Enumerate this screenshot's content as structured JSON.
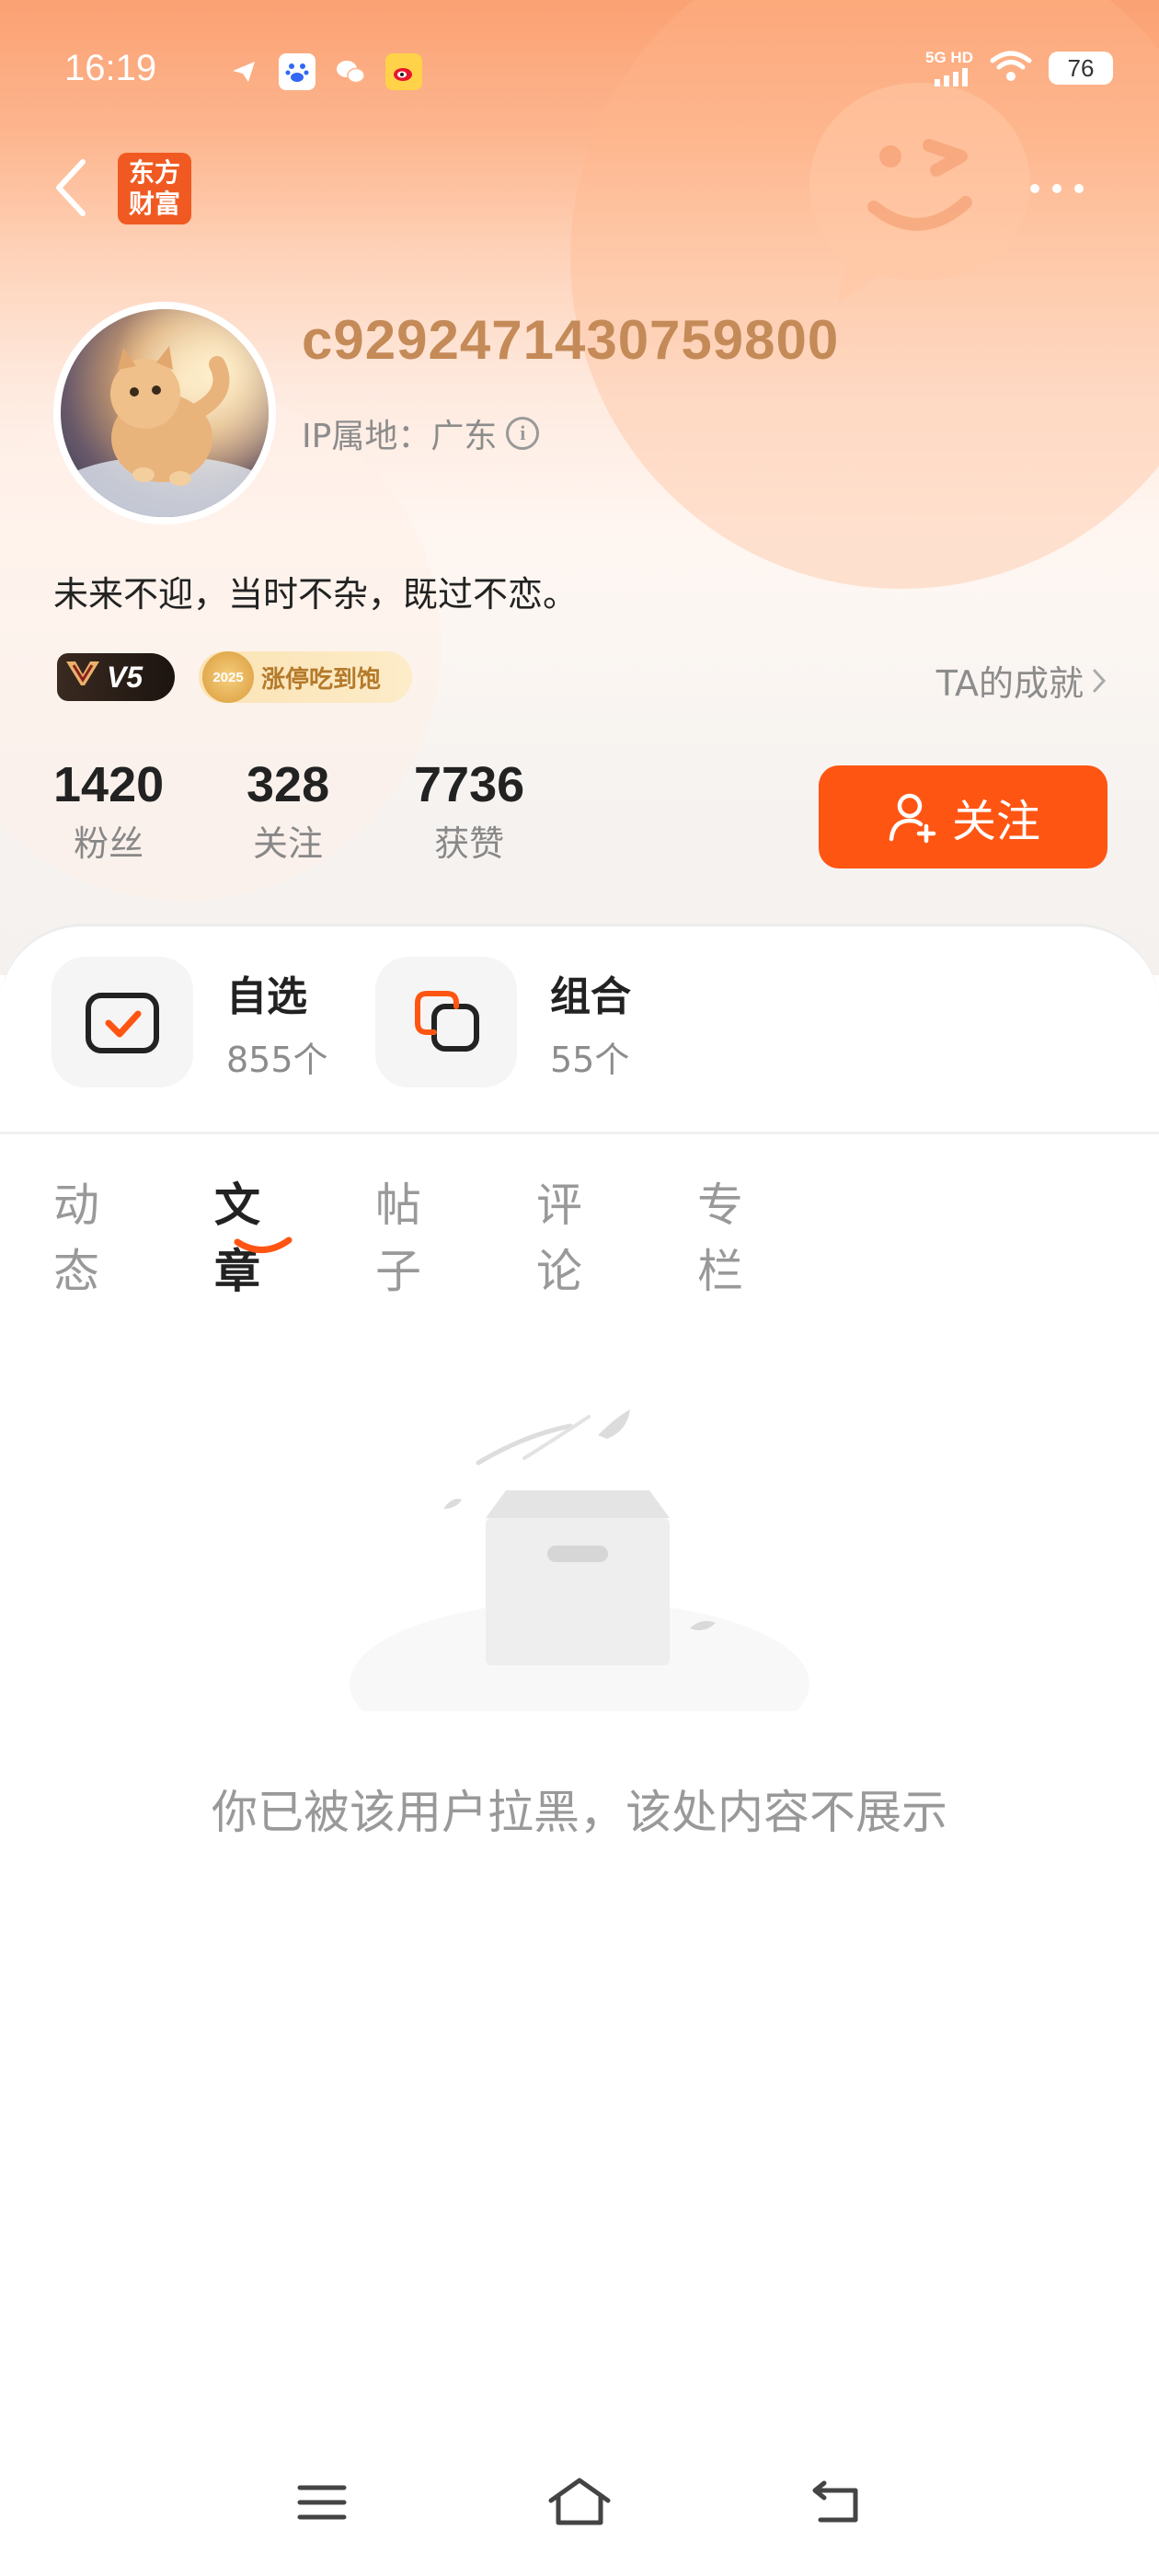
{
  "status_bar": {
    "time": "16:19",
    "network": "5G HD",
    "battery": "76"
  },
  "brand": {
    "line1": "东方",
    "line2": "财富"
  },
  "profile": {
    "username": "c9292471430759800",
    "ip_label": "IP属地：广东",
    "bio": "未来不迎，当时不杂，既过不恋。",
    "level_badge": "V5",
    "year_badge_coin": "2025",
    "year_badge_text": "涨停吃到饱",
    "achievements_link": "TA的成就"
  },
  "stats": {
    "fans": {
      "value": "1420",
      "label": "粉丝"
    },
    "following": {
      "value": "328",
      "label": "关注"
    },
    "likes": {
      "value": "7736",
      "label": "获赞"
    }
  },
  "follow_button": {
    "label": "关注"
  },
  "quick_links": [
    {
      "title": "自选",
      "count": "855个"
    },
    {
      "title": "组合",
      "count": "55个"
    }
  ],
  "tabs": [
    {
      "label": "动态",
      "active": false
    },
    {
      "label": "文章",
      "active": true
    },
    {
      "label": "帖子",
      "active": false
    },
    {
      "label": "评论",
      "active": false
    },
    {
      "label": "专栏",
      "active": false
    }
  ],
  "empty_state": {
    "message": "你已被该用户拉黑，该处内容不展示"
  },
  "colors": {
    "accent": "#ff5513",
    "username": "#c48a58",
    "brand": "#f05a22"
  },
  "icons": {
    "back": "chevron-left-icon",
    "more": "more-dots-icon",
    "info": "info-icon",
    "follow": "add-user-icon",
    "watchlist": "checkbox-icon",
    "portfolio": "overlap-squares-icon",
    "nav_menu": "menu-icon",
    "nav_home": "home-icon",
    "nav_back": "return-icon"
  }
}
